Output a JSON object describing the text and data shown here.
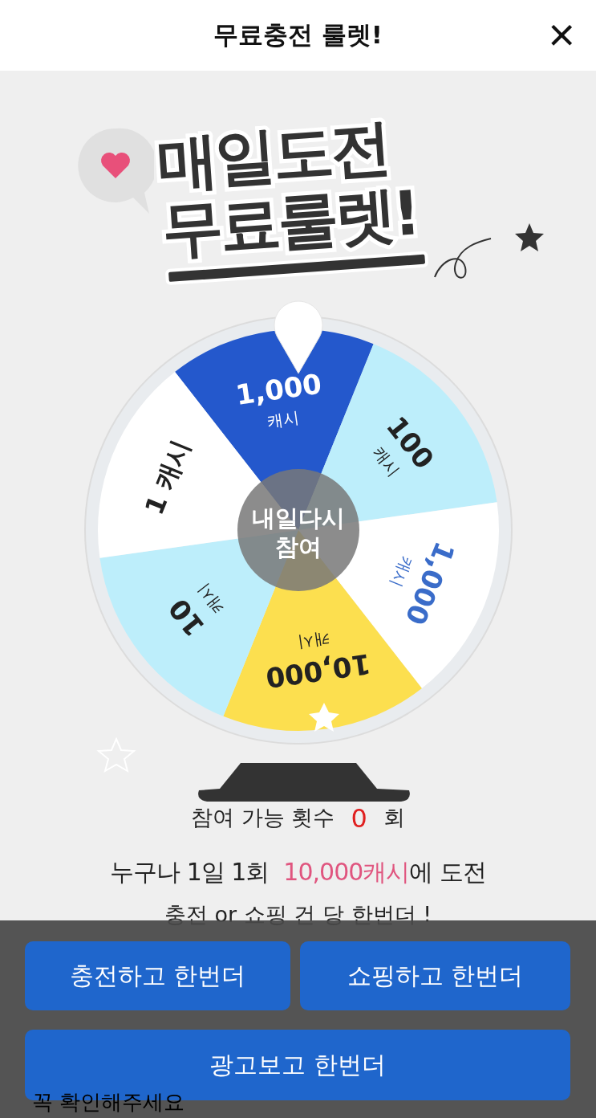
{
  "header": {
    "title": "무료충전 룰렛!",
    "close": "×"
  },
  "hero": {
    "lines": [
      "매일도전",
      "무료룰렛!"
    ]
  },
  "wheel": {
    "segments": [
      {
        "value": "1,000",
        "unit": "캐시",
        "color": "#2458cc",
        "kind": "inverse"
      },
      {
        "value": "100",
        "unit": "캐시",
        "color": "#bdeefb",
        "kind": "plain"
      },
      {
        "value": "1,000",
        "unit": "캐시",
        "color": "#ffffff",
        "kind": "accent"
      },
      {
        "value": "10,000",
        "unit": "캐시",
        "color": "#fcdf4f",
        "kind": "plain"
      },
      {
        "value": "10",
        "unit": "캐시",
        "color": "#bdeefb",
        "kind": "plain"
      },
      {
        "value": "1 캐시",
        "color": "#ffffff",
        "kind": "plain"
      }
    ],
    "center_label": [
      "내일다시",
      "참여"
    ]
  },
  "attempts": {
    "label": "참여 가능 횟수",
    "count": "0",
    "unit": "회"
  },
  "promo": {
    "prefix": "누구나 1일 1회",
    "highlight": "10,000캐시",
    "suffix": "에 도전"
  },
  "note": "충전 or 쇼핑 건 당 한번더 !",
  "buttons": [
    {
      "label": "충전하고 한번더"
    },
    {
      "label": "쇼핑하고 한번더"
    },
    {
      "label": "광고보고 한번더"
    }
  ],
  "footer_note": "꼭 확인해주세요"
}
